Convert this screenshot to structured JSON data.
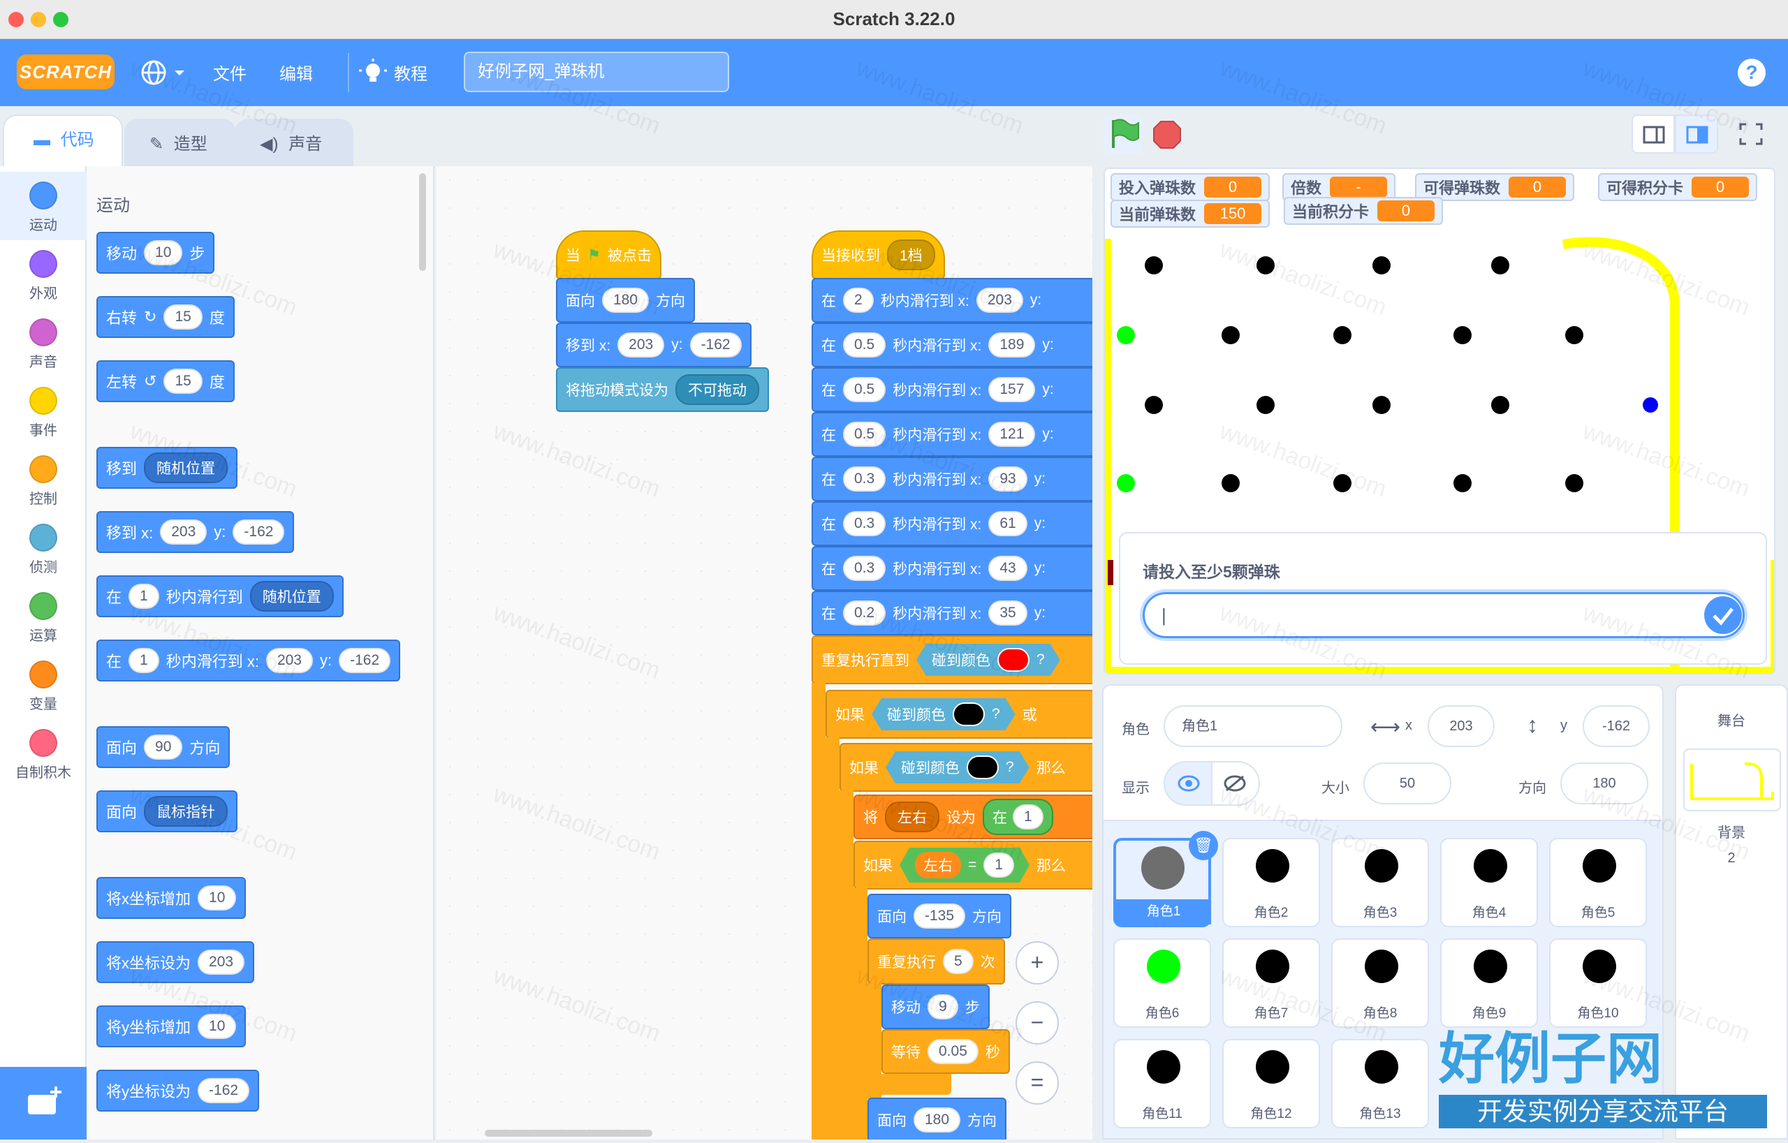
{
  "window": {
    "title": "Scratch 3.22.0"
  },
  "menubar": {
    "logo": "SCRATCH",
    "file": "文件",
    "edit": "编辑",
    "tutorials": "教程",
    "project_title": "好例子网_弹珠机",
    "help": "?"
  },
  "tabs": {
    "code": "代码",
    "costumes": "造型",
    "sounds": "声音"
  },
  "categories": [
    {
      "label": "运动",
      "color": "#4c97ff"
    },
    {
      "label": "外观",
      "color": "#9966ff"
    },
    {
      "label": "声音",
      "color": "#cf63cf"
    },
    {
      "label": "事件",
      "color": "#ffd500"
    },
    {
      "label": "控制",
      "color": "#ffab19"
    },
    {
      "label": "侦测",
      "color": "#5cb1d6"
    },
    {
      "label": "运算",
      "color": "#59c059"
    },
    {
      "label": "变量",
      "color": "#ff8c1a"
    },
    {
      "label": "自制积木",
      "color": "#ff6680"
    }
  ],
  "palette": {
    "heading": "运动",
    "move": {
      "a": "移动",
      "v": "10",
      "b": "步"
    },
    "turn_right": {
      "a": "右转",
      "v": "15",
      "b": "度"
    },
    "turn_left": {
      "a": "左转",
      "v": "15",
      "b": "度"
    },
    "goto": {
      "a": "移到",
      "dd": "随机位置"
    },
    "goto_xy": {
      "a": "移到 x:",
      "x": "203",
      "b": "y:",
      "y": "-162"
    },
    "glide": {
      "a": "在",
      "v": "1",
      "b": "秒内滑行到",
      "dd": "随机位置"
    },
    "glide_xy": {
      "a": "在",
      "v": "1",
      "b": "秒内滑行到 x:",
      "x": "203",
      "c": "y:",
      "y": "-162"
    },
    "point": {
      "a": "面向",
      "v": "90",
      "b": "方向"
    },
    "point_towards": {
      "a": "面向",
      "dd": "鼠标指针"
    },
    "change_x": {
      "a": "将x坐标增加",
      "v": "10"
    },
    "set_x": {
      "a": "将x坐标设为",
      "v": "203"
    },
    "change_y": {
      "a": "将y坐标增加",
      "v": "10"
    },
    "set_y": {
      "a": "将y坐标设为",
      "v": "-162"
    }
  },
  "script1": {
    "hat": {
      "a": "当",
      "b": "被点击"
    },
    "point": {
      "a": "面向",
      "v": "180",
      "b": "方向"
    },
    "goto": {
      "a": "移到 x:",
      "x": "203",
      "b": "y:",
      "y": "-162"
    },
    "drag": {
      "a": "将拖动模式设为",
      "dd": "不可拖动"
    }
  },
  "script2": {
    "hat": {
      "a": "当接收到",
      "dd": "1档"
    },
    "glides": [
      {
        "a": "在",
        "t": "2",
        "b": "秒内滑行到 x:",
        "x": "203",
        "c": "y:"
      },
      {
        "a": "在",
        "t": "0.5",
        "b": "秒内滑行到 x:",
        "x": "189",
        "c": "y:"
      },
      {
        "a": "在",
        "t": "0.5",
        "b": "秒内滑行到 x:",
        "x": "157",
        "c": "y:"
      },
      {
        "a": "在",
        "t": "0.5",
        "b": "秒内滑行到 x:",
        "x": "121",
        "c": "y:"
      },
      {
        "a": "在",
        "t": "0.3",
        "b": "秒内滑行到 x:",
        "x": "93",
        "c": "y:"
      },
      {
        "a": "在",
        "t": "0.3",
        "b": "秒内滑行到 x:",
        "x": "61",
        "c": "y:"
      },
      {
        "a": "在",
        "t": "0.3",
        "b": "秒内滑行到 x:",
        "x": "43",
        "c": "y:"
      },
      {
        "a": "在",
        "t": "0.2",
        "b": "秒内滑行到 x:",
        "x": "35",
        "c": "y:"
      }
    ],
    "repeat_until": {
      "a": "重复执行直到",
      "touch": "碰到颜色",
      "q": "?"
    },
    "if1": {
      "a": "如果",
      "touch": "碰到颜色",
      "q": "?",
      "or": "或"
    },
    "if2": {
      "a": "如果",
      "touch": "碰到颜色",
      "q": "?",
      "then": "那么"
    },
    "set_var": {
      "a": "将",
      "dd": "左右",
      "b": "设为",
      "c": "在",
      "v": "1"
    },
    "if3": {
      "a": "如果",
      "var": "左右",
      "eq": "=",
      "v": "1",
      "then": "那么"
    },
    "point1": {
      "a": "面向",
      "v": "-135",
      "b": "方向"
    },
    "repeat": {
      "a": "重复执行",
      "v": "5",
      "b": "次"
    },
    "move": {
      "a": "移动",
      "v": "9",
      "b": "步"
    },
    "wait": {
      "a": "等待",
      "v": "0.05",
      "b": "秒"
    },
    "point2": {
      "a": "面向",
      "v": "180",
      "b": "方向"
    }
  },
  "zoom": {
    "in": "+",
    "out": "−",
    "reset": "="
  },
  "stage": {
    "monitors": [
      {
        "label": "投入弹珠数",
        "value": "0"
      },
      {
        "label": "倍数",
        "value": "-"
      },
      {
        "label": "可得弹珠数",
        "value": "0"
      },
      {
        "label": "可得积分卡",
        "value": "0"
      },
      {
        "label": "当前弹珠数",
        "value": "150"
      },
      {
        "label": "当前积分卡",
        "value": "0"
      }
    ],
    "ask_prompt": "请投入至少5颗弹珠",
    "ask_value": "|"
  },
  "sprite_info": {
    "sprite_label": "角色",
    "sprite_name": "角色1",
    "x_label": "x",
    "x": "203",
    "y_label": "y",
    "y": "-162",
    "show_label": "显示",
    "size_label": "大小",
    "size": "50",
    "direction_label": "方向",
    "direction": "180"
  },
  "sprites": [
    {
      "name": "角色1",
      "color": "#6e6e6e"
    },
    {
      "name": "角色2",
      "color": "#000000"
    },
    {
      "name": "角色3",
      "color": "#000000"
    },
    {
      "name": "角色4",
      "color": "#000000"
    },
    {
      "name": "角色5",
      "color": "#000000"
    },
    {
      "name": "角色6",
      "color": "#00ff00"
    },
    {
      "name": "角色7",
      "color": "#000000"
    },
    {
      "name": "角色8",
      "color": "#000000"
    },
    {
      "name": "角色9",
      "color": "#000000"
    },
    {
      "name": "角色10",
      "color": "#000000"
    },
    {
      "name": "角色11",
      "color": "#000000"
    },
    {
      "name": "角色12",
      "color": "#000000"
    },
    {
      "name": "角色13",
      "color": "#000000"
    }
  ],
  "stage_pane": {
    "label": "舞台",
    "backdrop_label": "背景",
    "backdrop_count": "2"
  },
  "watermark": {
    "site": "www.haolizi.com",
    "brand": "好例子网",
    "slogan": "开发实例分享交流平台"
  },
  "colors": {
    "scratch_blue": "#4c97ff",
    "pen_yellow": "#ffff00",
    "red_touch": "#ff0000"
  }
}
